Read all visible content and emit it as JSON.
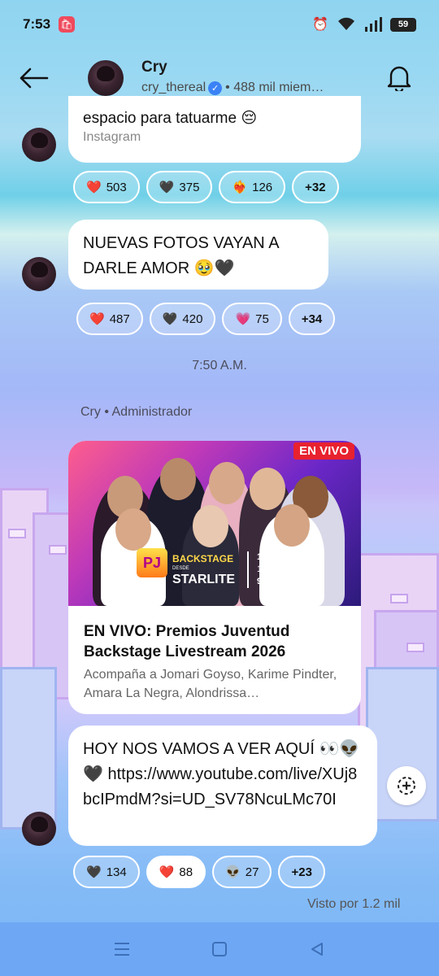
{
  "status_bar": {
    "time": "7:53",
    "battery": "59"
  },
  "header": {
    "channel_name": "Cry",
    "username": "cry_thereal",
    "members": "• 488 mil miem…"
  },
  "messages": [
    {
      "text_line": "espacio para tatuarme 😔",
      "source": "Instagram",
      "reactions": [
        {
          "emoji": "❤️",
          "count": "503"
        },
        {
          "emoji": "🖤",
          "count": "375"
        },
        {
          "emoji": "❤️‍🔥",
          "count": "126"
        },
        {
          "emoji": "",
          "count": "+32"
        }
      ]
    },
    {
      "text": "NUEVAS FOTOS VAYAN A DARLE AMOR 🥹🖤",
      "reactions": [
        {
          "emoji": "❤️",
          "count": "487"
        },
        {
          "emoji": "🖤",
          "count": "420"
        },
        {
          "emoji": "💗",
          "count": "75"
        },
        {
          "emoji": "",
          "count": "+34"
        }
      ]
    }
  ],
  "timestamp": "7:50 A.M.",
  "sender_label": "Cry • Administrador",
  "video_card": {
    "live_badge": "EN VIVO",
    "logo_letters": "PJ",
    "logo_text": "BACKSTAGE",
    "logo_desde": "DESDE",
    "logo_venue": "STARLITE",
    "times": [
      "12:45P",
      "11:45C",
      "9:45PAC"
    ],
    "title": "EN VIVO: Premios Juventud Backstage Livestream 2026",
    "description": "Acompaña a Jomari Goyso, Karime Pindter, Amara La Negra, Alondrissa…"
  },
  "last_message": {
    "text": "HOY NOS VAMOS A VER AQUÍ 👀👽🖤 https://www.youtube.com/live/XUj8bcIPmdM?si=UD_SV78NcuLMc70I",
    "reactions": [
      {
        "emoji": "🖤",
        "count": "134"
      },
      {
        "emoji": "❤️",
        "count": "88",
        "selected": true
      },
      {
        "emoji": "👽",
        "count": "27"
      },
      {
        "emoji": "",
        "count": "+23"
      }
    ]
  },
  "seen_by": "Visto por 1.2 mil",
  "icons": {
    "back": "arrow-left-icon",
    "bell": "bell-icon",
    "verified": "verified-icon",
    "scroll": "add-reaction-icon",
    "nav": [
      "menu-icon",
      "home-icon",
      "back-triangle-icon"
    ]
  },
  "colors": {
    "accent": "#3b82f6",
    "live": "#e8222f",
    "nav_bar": "#6ea8f4"
  }
}
